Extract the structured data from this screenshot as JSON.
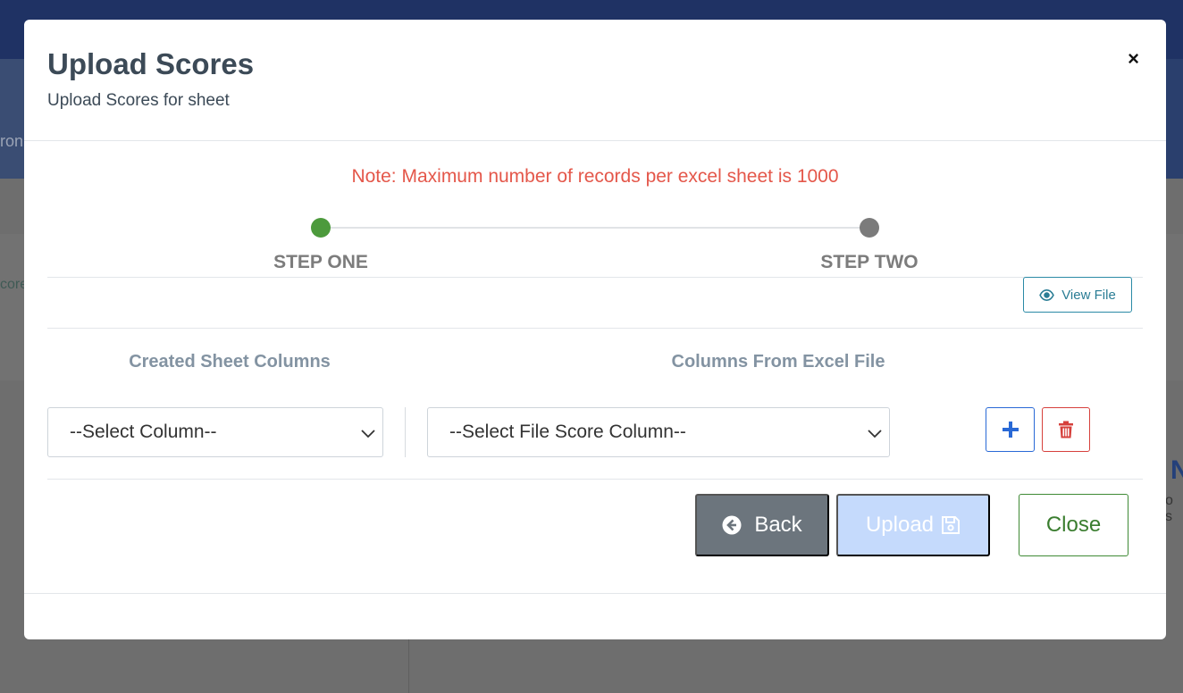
{
  "background": {
    "left_fragment_1": "ron",
    "left_fragment_2": "core",
    "right_fragment_1": "N",
    "right_fragment_2": "o s"
  },
  "modal": {
    "title": "Upload Scores",
    "subtitle": "Upload Scores for sheet",
    "close_symbol": "×",
    "note": "Note: Maximum number of records per excel sheet is 1000",
    "steps": [
      {
        "label": "STEP ONE",
        "status": "active",
        "color": "#4c9a3c"
      },
      {
        "label": "STEP TWO",
        "status": "pending",
        "color": "#7b7b7b"
      }
    ],
    "view_file_label": "View File",
    "columns": {
      "created_header": "Created Sheet Columns",
      "excel_header": "Columns From Excel File",
      "created_select_value": "--Select Column--",
      "excel_select_value": "--Select File Score Column--"
    },
    "buttons": {
      "back": "Back",
      "upload": "Upload",
      "close": "Close"
    },
    "icons": {
      "view_file": "eye-icon",
      "add": "plus-icon",
      "delete": "trash-icon",
      "back": "arrow-left-circle-icon",
      "upload": "floppy-disk-icon",
      "select": "chevron-down-icon"
    },
    "colors": {
      "note": "#e4574a",
      "back_bg": "#6c757d",
      "upload_bg": "#c5dafc",
      "close_border": "#3f8a35",
      "add_border": "#2969d6",
      "delete_border": "#d6403c"
    }
  }
}
